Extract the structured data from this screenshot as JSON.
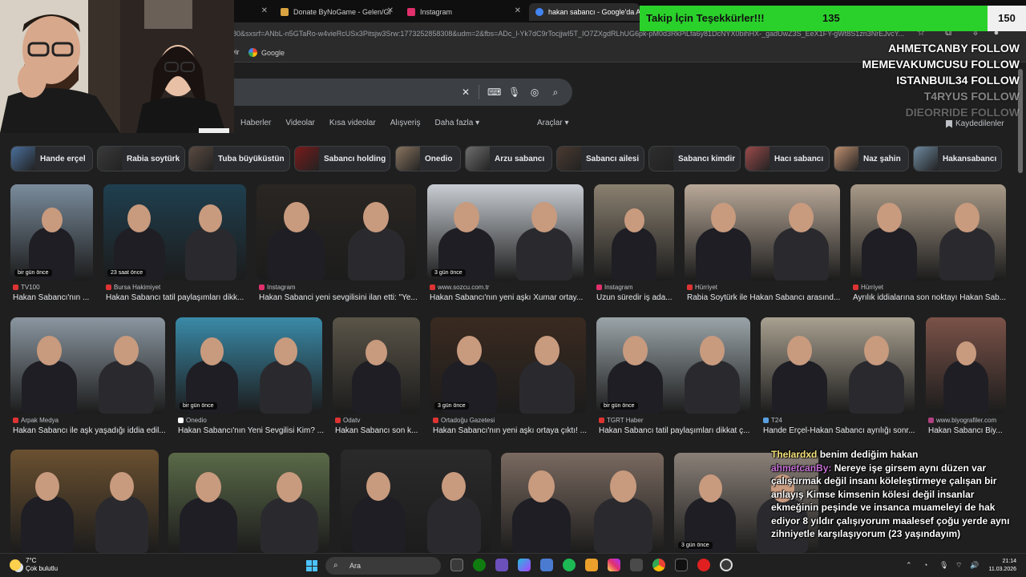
{
  "tabs": [
    {
      "label": "",
      "favicon_color": "#888888"
    },
    {
      "label": "Donate ByNoGame - Gelen/Gi",
      "favicon_color": "#d9a441"
    },
    {
      "label": "Instagram",
      "favicon_color": "#e1306c"
    },
    {
      "label": "hakan sabancı - Google'da Ara",
      "favicon_color": "#4285f4"
    }
  ],
  "url": "80&sxsrf=ANbL-n5GTaRo-w4vieRcUSx3Pitsjw3Srw:1773252858308&udm=2&fbs=ADc_l-Yk7dC9rTocjjwI5T_IO7ZXgdRLhUG6pk-pM0d3RkPiLfa6y81DcNYX0bihHX-_gadUwZ3S_EeX1FY-gWt8S1zn3NrEJvcY...",
  "bookmarks": {
    "partial": "vir",
    "google": "Google"
  },
  "nav_tabs": [
    "Haberler",
    "Videolar",
    "Kısa videolar",
    "Alışveriş",
    "Daha fazla ▾"
  ],
  "tools_label": "Araçlar ▾",
  "saved_label": "Kaydedilenler",
  "chips": [
    {
      "label": "Hande erçel",
      "color": "#4a6f9c"
    },
    {
      "label": "Rabia soytürk",
      "color": "#3a3a3a"
    },
    {
      "label": "Tuba büyüküstün",
      "color": "#5a4a40"
    },
    {
      "label": "Sabancı holding",
      "color": "#7a1a1a"
    },
    {
      "label": "Onedio",
      "color": "#8a7560"
    },
    {
      "label": "Arzu sabancı",
      "color": "#6e6e6e"
    },
    {
      "label": "Sabancı ailesi",
      "color": "#4a3a30"
    },
    {
      "label": "Sabancı kimdir",
      "color": "#2e2e2e"
    },
    {
      "label": "Hacı sabancı",
      "color": "#9c4a4a"
    },
    {
      "label": "Naz şahin",
      "color": "#c09070"
    },
    {
      "label": "Hakansabancı",
      "color": "#6e8aa0"
    }
  ],
  "results": [
    {
      "source": "TV100",
      "title": "Hakan Sabancı'nın ...",
      "ago": "bir gün önce",
      "bg": "#7a8c9c",
      "src_color": "#d33"
    },
    {
      "source": "Bursa Hakimiyet",
      "title": "Hakan Sabancı tatil paylaşımları dikk...",
      "ago": "23 saat önce",
      "bg": "#1f3f4f",
      "src_color": "#d33"
    },
    {
      "source": "Instagram",
      "title": "Hakan Sabanci yeni sevgilisini ilan etti: \"Ye...",
      "ago": "",
      "bg": "#2a2622",
      "src_color": "#e1306c"
    },
    {
      "source": "www.sozcu.com.tr",
      "title": "Hakan Sabancı'nın yeni aşkı Xumar ortay...",
      "ago": "3 gün önce",
      "bg": "#c8cdd3",
      "src_color": "#d33"
    },
    {
      "source": "Instagram",
      "title": "Uzun süredir iş ada...",
      "ago": "",
      "bg": "#8a8070",
      "src_color": "#e1306c"
    },
    {
      "source": "Hürriyet",
      "title": "Rabia Soytürk ile Hakan Sabancı arasınd...",
      "ago": "",
      "bg": "#b8a898",
      "src_color": "#d33"
    },
    {
      "source": "Hürriyet",
      "title": "Ayrılık iddialarına son noktayı Hakan Sab...",
      "ago": "",
      "bg": "#a89a88",
      "src_color": "#d33"
    },
    {
      "source": "Arpak Medya",
      "title": "Hakan Sabancı ile aşk yaşadığı iddia edil...",
      "ago": "",
      "bg": "#8a96a0",
      "src_color": "#d33"
    },
    {
      "source": "Onedio",
      "title": "Hakan Sabancı'nın Yeni Sevgilisi Kim? ...",
      "ago": "bir gün önce",
      "bg": "#3a8aa8",
      "src_color": "#fff"
    },
    {
      "source": "Odatv",
      "title": "Hakan Sabancı son k...",
      "ago": "",
      "bg": "#5a5448",
      "src_color": "#d33"
    },
    {
      "source": "Ortadoğu Gazetesi",
      "title": "Hakan Sabancı'nın yeni aşkı ortaya çıktı! ...",
      "ago": "3 gün önce",
      "bg": "#3a2a20",
      "src_color": "#d33"
    },
    {
      "source": "TGRT Haber",
      "title": "Hakan Sabancı tatil paylaşımları dikkat ç...",
      "ago": "bir gün önce",
      "bg": "#9aa4a8",
      "src_color": "#d33"
    },
    {
      "source": "T24",
      "title": "Hande Erçel-Hakan Sabancı ayrılığı sonr...",
      "ago": "",
      "bg": "#a8a090",
      "src_color": "#5aa0e0"
    },
    {
      "source": "www.biyografiler.com",
      "title": "Hakan Sabancı Biy...",
      "ago": "",
      "bg": "#7a5248",
      "src_color": "#b04080"
    },
    {
      "source": "",
      "title": "",
      "ago": "",
      "bg": "#6a5030",
      "src_color": "#000"
    },
    {
      "source": "",
      "title": "",
      "ago": "",
      "bg": "#5a6a48",
      "src_color": "#000"
    },
    {
      "source": "",
      "title": "",
      "ago": "",
      "bg": "#2a2a2a",
      "src_color": "#000"
    },
    {
      "source": "",
      "title": "",
      "ago": "",
      "bg": "#7a6a60",
      "src_color": "#000"
    },
    {
      "source": "",
      "title": "",
      "ago": "3 gün önce",
      "bg": "#8a8078",
      "src_color": "#000"
    }
  ],
  "taskbar": {
    "temp": "7°C",
    "weather": "Çok bulutlu",
    "search": "Ara",
    "time": "21:14",
    "date": "11.03.2026"
  },
  "overlay": {
    "follow_label": "Takip İçin Teşekkürler!!!",
    "follow_count": "135",
    "follow_goal": "150",
    "followers": [
      "AHMETCANBY FOLLOW",
      "MEMEVAKUMCUSU FOLLOW",
      "ISTANBUIL34 FOLLOW",
      "T4RYUS FOLLOW",
      "DIEORRIDE FOLLOW"
    ],
    "chat_user1": "Thelardxd",
    "chat_msg1": " benim dediğim hakan",
    "chat_user2": "ahmetcanBy:",
    "chat_msg2": " Nereye işe girsem aynı düzen var çalıştırmak değil insanı köleleştirmeye çalışan bir anlayış Kimse kimsenin kölesi değil insanlar ekmeğinin peşinde ve insanca muameleyi de hak ediyor 8 yıldır çalışıyorum maalesef çoğu yerde aynı zihniyetle karşılaşıyorum (23 yaşındayım)"
  }
}
